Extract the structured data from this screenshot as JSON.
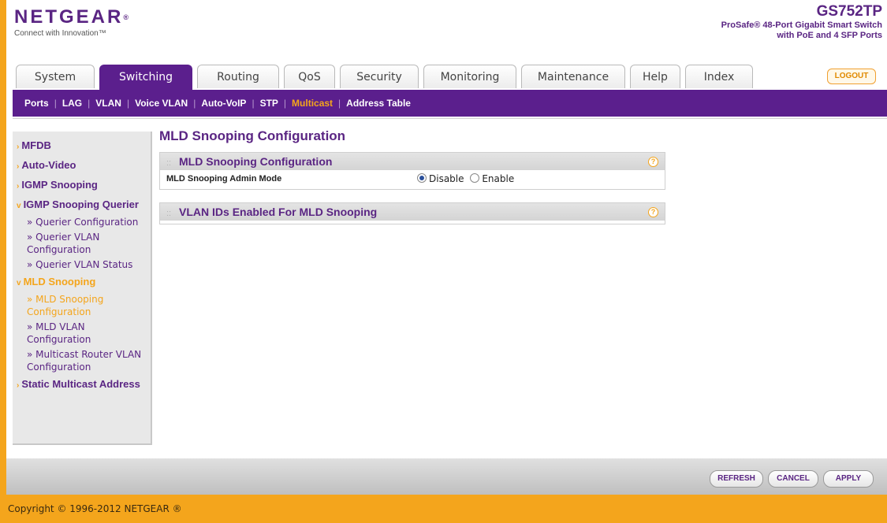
{
  "header": {
    "logo": "NETGEAR",
    "tagline": "Connect with Innovation™",
    "model": "GS752TP",
    "description": "ProSafe® 48-Port Gigabit Smart Switch with PoE and 4 SFP Ports"
  },
  "tabs": [
    {
      "label": "System",
      "active": false
    },
    {
      "label": "Switching",
      "active": true
    },
    {
      "label": "Routing",
      "active": false
    },
    {
      "label": "QoS",
      "active": false
    },
    {
      "label": "Security",
      "active": false
    },
    {
      "label": "Monitoring",
      "active": false
    },
    {
      "label": "Maintenance",
      "active": false
    },
    {
      "label": "Help",
      "active": false
    },
    {
      "label": "Index",
      "active": false
    }
  ],
  "logout_label": "LOGOUT",
  "subnav": [
    {
      "label": "Ports",
      "active": false
    },
    {
      "label": "LAG",
      "active": false
    },
    {
      "label": "VLAN",
      "active": false
    },
    {
      "label": "Voice VLAN",
      "active": false
    },
    {
      "label": "Auto-VoIP",
      "active": false
    },
    {
      "label": "STP",
      "active": false
    },
    {
      "label": "Multicast",
      "active": true
    },
    {
      "label": "Address Table",
      "active": false
    }
  ],
  "sidebar": [
    {
      "label": "MFDB",
      "level": 1,
      "marker": "›"
    },
    {
      "label": "Auto-Video",
      "level": 1,
      "marker": "›"
    },
    {
      "label": "IGMP Snooping",
      "level": 1,
      "marker": "›"
    },
    {
      "label": "IGMP Snooping Querier",
      "level": 1,
      "marker": "v"
    },
    {
      "label": "» Querier Configuration",
      "level": 2
    },
    {
      "label": "» Querier VLAN Configuration",
      "level": 2
    },
    {
      "label": "» Querier VLAN Status",
      "level": 2
    },
    {
      "label": "MLD Snooping",
      "level": 1,
      "marker": "v",
      "highlight": true
    },
    {
      "label": "» MLD Snooping Configuration",
      "level": 2,
      "active": true
    },
    {
      "label": "» MLD VLAN Configuration",
      "level": 2
    },
    {
      "label": "» Multicast Router VLAN Configuration",
      "level": 2
    },
    {
      "label": "Static Multicast Address",
      "level": 1,
      "marker": "›"
    }
  ],
  "main": {
    "title": "MLD Snooping Configuration",
    "config_box": {
      "title": "MLD Snooping Configuration",
      "admin_mode_label": "MLD Snooping Admin Mode",
      "options": [
        {
          "label": "Disable",
          "checked": true
        },
        {
          "label": "Enable",
          "checked": false
        }
      ]
    },
    "vlan_box": {
      "title": "VLAN IDs Enabled For MLD Snooping"
    }
  },
  "buttons": {
    "refresh": "REFRESH",
    "cancel": "CANCEL",
    "apply": "APPLY"
  },
  "copyright": "Copyright © 1996-2012 NETGEAR ®",
  "colors": {
    "brand_purple": "#5b1f8d",
    "accent_orange": "#f4a51c"
  }
}
